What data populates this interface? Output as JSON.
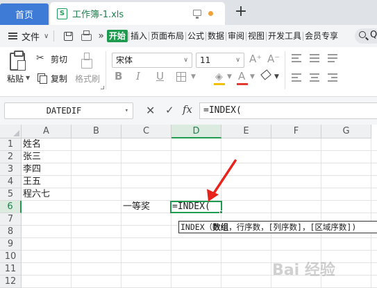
{
  "tabbar": {
    "home": "首页",
    "doc_title": "工作簿-1.xls",
    "xls_badge": "S"
  },
  "menubar": {
    "file": "文件",
    "more": "»",
    "tabs": [
      "开始",
      "插入",
      "页面布局",
      "公式",
      "数据",
      "审阅",
      "视图",
      "开发工具",
      "会员专享"
    ],
    "active_tab": "开始",
    "search_q": "Q"
  },
  "ribbon": {
    "paste": "粘贴",
    "cut": "剪切",
    "copy": "复制",
    "format_painter": "格式刷",
    "font_name": "宋体",
    "font_size": "11",
    "bold": "B",
    "italic": "I",
    "underline": "U",
    "fill_color": "#f3c000",
    "font_color": "#e23b2e"
  },
  "formula_bar": {
    "name_box": "DATEDIF",
    "cancel": "✕",
    "confirm": "✓",
    "fx": "fx",
    "formula": "=INDEX("
  },
  "sheet": {
    "columns": [
      "A",
      "B",
      "C",
      "D",
      "E",
      "F",
      "G"
    ],
    "selected_column": "D",
    "rows": [
      "1",
      "2",
      "3",
      "4",
      "5",
      "6",
      "7",
      "8",
      "9",
      "10",
      "11",
      "12"
    ],
    "selected_row": "6",
    "cells": {
      "A1": "姓名",
      "A2": "张三",
      "A3": "李四",
      "A4": "王五",
      "A5": "程六七",
      "C6": "一等奖",
      "D6": "=INDEX("
    },
    "tooltip": {
      "func": "INDEX",
      "open": "（",
      "arg_active": "数组",
      "rest": "，行序数，[列序数]，[区域序数])"
    }
  },
  "accent_color": "#1e9b4e",
  "arrow_color": "#e8231c",
  "watermark": "Bai 经验"
}
